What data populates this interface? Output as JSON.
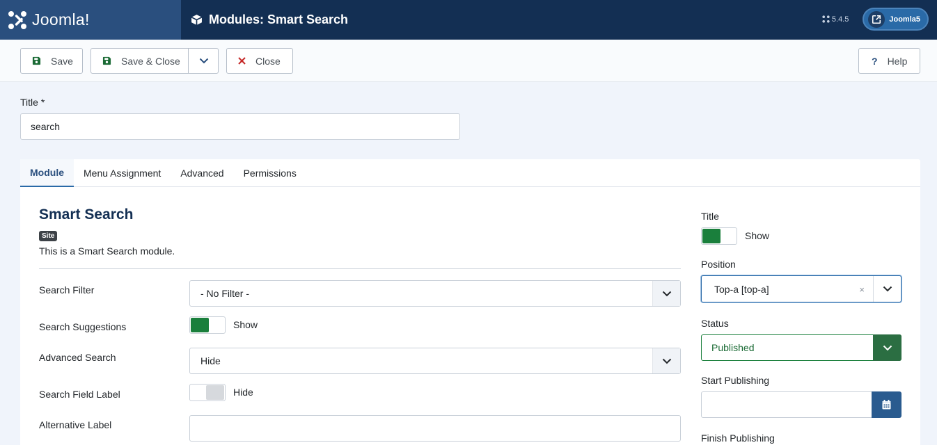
{
  "header": {
    "brand_name": "Joomla!",
    "page_title": "Modules: Smart Search",
    "version": "5.4.5",
    "site_link_label": "Joomla5"
  },
  "toolbar": {
    "save_label": "Save",
    "save_close_label": "Save & Close",
    "close_label": "Close",
    "help_label": "Help"
  },
  "title_field": {
    "label": "Title *",
    "value": "search"
  },
  "tabs": [
    {
      "label": "Module",
      "active": true
    },
    {
      "label": "Menu Assignment",
      "active": false
    },
    {
      "label": "Advanced",
      "active": false
    },
    {
      "label": "Permissions",
      "active": false
    }
  ],
  "module": {
    "heading": "Smart Search",
    "badge": "Site",
    "description": "This is a Smart Search module."
  },
  "fields": {
    "search_filter": {
      "label": "Search Filter",
      "value": "- No Filter -"
    },
    "search_suggestions": {
      "label": "Search Suggestions",
      "state": "Show"
    },
    "advanced_search": {
      "label": "Advanced Search",
      "value": "Hide"
    },
    "search_field_label": {
      "label": "Search Field Label",
      "state": "Hide"
    },
    "alternative_label": {
      "label": "Alternative Label",
      "value": ""
    }
  },
  "sidebar": {
    "title": {
      "label": "Title",
      "state": "Show"
    },
    "position": {
      "label": "Position",
      "value": "Top-a [top-a]",
      "clear": "×"
    },
    "status": {
      "label": "Status",
      "value": "Published"
    },
    "start_publishing": {
      "label": "Start Publishing",
      "value": ""
    },
    "finish_publishing": {
      "label": "Finish Publishing"
    }
  },
  "colors": {
    "header_bg": "#132f53",
    "brand_bg": "#2a4f7e",
    "switch_on": "#1a7f3c",
    "status_green": "#2b6e42",
    "calendar_btn": "#2a5b8f",
    "close_icon": "#c52827"
  }
}
